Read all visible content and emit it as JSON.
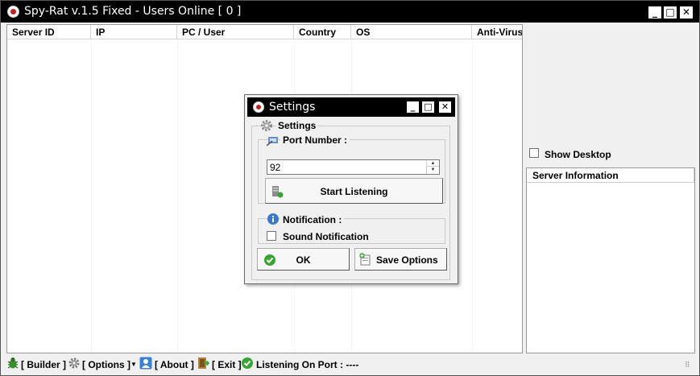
{
  "app": {
    "title": "Spy-Rat v.1.5 Fixed - Users Online [ 0 ]"
  },
  "window_buttons": {
    "minimize": "_",
    "maximize": "□",
    "close": "✕"
  },
  "users_table": {
    "columns": [
      "Server ID",
      "IP",
      "PC / User",
      "Country",
      "OS",
      "Anti-Virus"
    ],
    "rows": []
  },
  "right_panel": {
    "show_desktop_label": "Show Desktop",
    "show_desktop_checked": false,
    "server_info_header": "Server Information"
  },
  "status_bar": {
    "builder": "[ Builder ]",
    "options": "[ Options ]",
    "about": "[ About ]",
    "exit": "[ Exit ]",
    "listening": "Listening On Port : ----"
  },
  "settings_dialog": {
    "title": "Settings",
    "group_settings": "Settings",
    "group_port": "Port Number :",
    "port_value": "92",
    "start_listening": "Start Listening",
    "group_notification": "Notification :",
    "sound_notification": "Sound Notification",
    "sound_notification_checked": false,
    "ok": "OK",
    "save_options": "Save Options"
  },
  "colors": {
    "titlebar": "#000000",
    "window_bg": "#f0f0f0",
    "list_bg": "#ffffff",
    "accent_red": "#c81e1e",
    "ok_green": "#3aa335"
  }
}
